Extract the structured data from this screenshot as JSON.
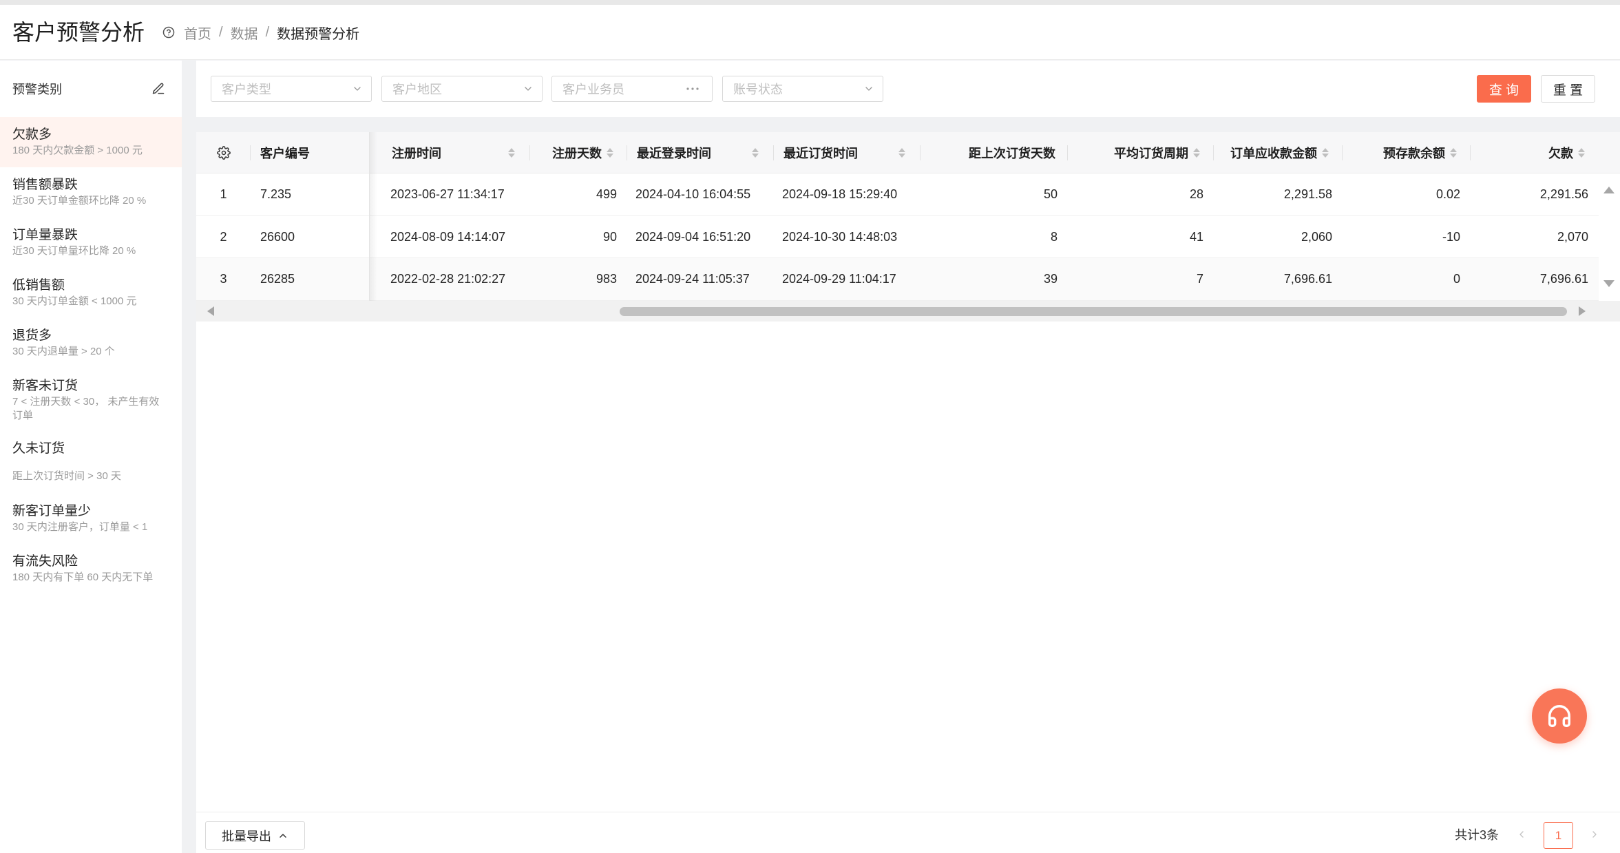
{
  "header": {
    "title": "客户预警分析",
    "breadcrumb": {
      "separator": "/",
      "items": [
        "首页",
        "数据",
        "数据预警分析"
      ]
    }
  },
  "sidebar": {
    "title": "预警类别",
    "items": [
      {
        "title": "欠款多",
        "desc": "180 天内欠款金额 > 1000 元",
        "selected": true
      },
      {
        "title": "销售额暴跌",
        "desc": "近30 天订单金额环比降 20 %"
      },
      {
        "title": "订单量暴跌",
        "desc": "近30 天订单量环比降 20 %"
      },
      {
        "title": "低销售额",
        "desc": "30 天内订单金额 < 1000 元"
      },
      {
        "title": "退货多",
        "desc": "30 天内退单量 > 20 个"
      },
      {
        "title": "新客未订货",
        "desc": "7 < 注册天数 < 30， 未产生有效订单"
      },
      {
        "title": "久未订货",
        "desc": "距上次订货时间 > 30 天"
      },
      {
        "title": "新客订单量少",
        "desc": "30 天内注册客户，订单量 < 1"
      },
      {
        "title": "有流失风险",
        "desc": "180 天内有下单 60 天内无下单"
      }
    ]
  },
  "filters": {
    "customer_type": {
      "placeholder": "客户类型"
    },
    "customer_region": {
      "placeholder": "客户地区"
    },
    "salesperson": {
      "placeholder": "客户业务员"
    },
    "account_status": {
      "placeholder": "账号状态"
    },
    "search_label": "查 询",
    "reset_label": "重 置"
  },
  "table": {
    "columns": [
      {
        "label": "客户编号",
        "sortable": false
      },
      {
        "label": "注册时间",
        "sortable": true
      },
      {
        "label": "注册天数",
        "sortable": true
      },
      {
        "label": "最近登录时间",
        "sortable": true
      },
      {
        "label": "最近订货时间",
        "sortable": true
      },
      {
        "label": "距上次订货天数",
        "sortable": false
      },
      {
        "label": "平均订货周期",
        "sortable": true
      },
      {
        "label": "订单应收款金额",
        "sortable": true
      },
      {
        "label": "预存款余额",
        "sortable": true
      },
      {
        "label": "欠款",
        "sortable": true
      }
    ],
    "rows": [
      {
        "no": "1",
        "customer_code": "7.235",
        "register_time": "2023-06-27 11:34:17",
        "register_days": "499",
        "last_login_time": "2024-04-10 16:04:55",
        "last_order_time": "2024-09-18 15:29:40",
        "days_since_last_order": "50",
        "avg_order_cycle": "28",
        "order_receivable": "2,291.58",
        "prepaid_balance": "0.02",
        "debt": "2,291.56"
      },
      {
        "no": "2",
        "customer_code": "26600",
        "register_time": "2024-08-09 14:14:07",
        "register_days": "90",
        "last_login_time": "2024-09-04 16:51:20",
        "last_order_time": "2024-10-30 14:48:03",
        "days_since_last_order": "8",
        "avg_order_cycle": "41",
        "order_receivable": "2,060",
        "prepaid_balance": "-10",
        "debt": "2,070"
      },
      {
        "no": "3",
        "customer_code": "26285",
        "register_time": "2022-02-28 21:02:27",
        "register_days": "983",
        "last_login_time": "2024-09-24 11:05:37",
        "last_order_time": "2024-09-29 11:04:17",
        "days_since_last_order": "39",
        "avg_order_cycle": "7",
        "order_receivable": "7,696.61",
        "prepaid_balance": "0",
        "debt": "7,696.61"
      }
    ]
  },
  "footer": {
    "export_label": "批量导出",
    "total_text": "共计3条",
    "current_page": "1"
  },
  "icons": {
    "help": "help-circle-icon",
    "edit": "edit-icon",
    "settings": "gear-icon",
    "sort": "sort-icon",
    "support": "headset-icon"
  },
  "colors": {
    "accent": "#FA6C4C",
    "selected_item_bg": "#FFF3EF"
  }
}
